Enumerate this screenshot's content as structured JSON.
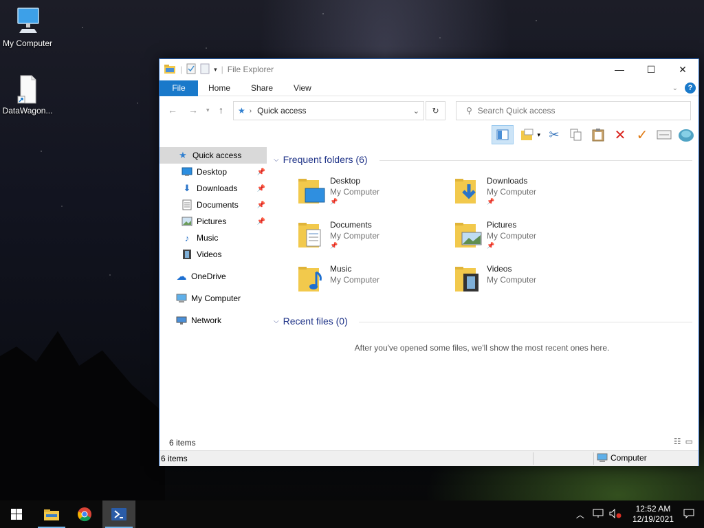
{
  "desktop": {
    "icons": [
      {
        "label": "My Computer",
        "icon": "computer-icon"
      },
      {
        "label": "DataWagon...",
        "icon": "shortcut-file-icon"
      }
    ]
  },
  "window": {
    "title": "File Explorer",
    "tabs": {
      "file": "File",
      "home": "Home",
      "share": "Share",
      "view": "View"
    },
    "help": "?",
    "address": {
      "crumb": "Quick access"
    },
    "search": {
      "placeholder": "Search Quick access"
    },
    "nav": {
      "quick_access": "Quick access",
      "desktop": "Desktop",
      "downloads": "Downloads",
      "documents": "Documents",
      "pictures": "Pictures",
      "music": "Music",
      "videos": "Videos",
      "onedrive": "OneDrive",
      "my_computer": "My Computer",
      "network": "Network"
    },
    "frequent": {
      "heading": "Frequent folders (6)",
      "folders": [
        {
          "name": "Desktop",
          "location": "My Computer",
          "pinned": true
        },
        {
          "name": "Downloads",
          "location": "My Computer",
          "pinned": true
        },
        {
          "name": "Documents",
          "location": "My Computer",
          "pinned": true
        },
        {
          "name": "Pictures",
          "location": "My Computer",
          "pinned": true
        },
        {
          "name": "Music",
          "location": "My Computer",
          "pinned": false
        },
        {
          "name": "Videos",
          "location": "My Computer",
          "pinned": false
        }
      ]
    },
    "recent": {
      "heading": "Recent files (0)",
      "empty_message": "After you've opened some files, we'll show the most recent ones here."
    },
    "status": {
      "item_count": "6 items",
      "bottom_count": "6 items",
      "location": "Computer"
    }
  },
  "taskbar": {
    "time": "12:52 AM",
    "date": "12/19/2021"
  }
}
